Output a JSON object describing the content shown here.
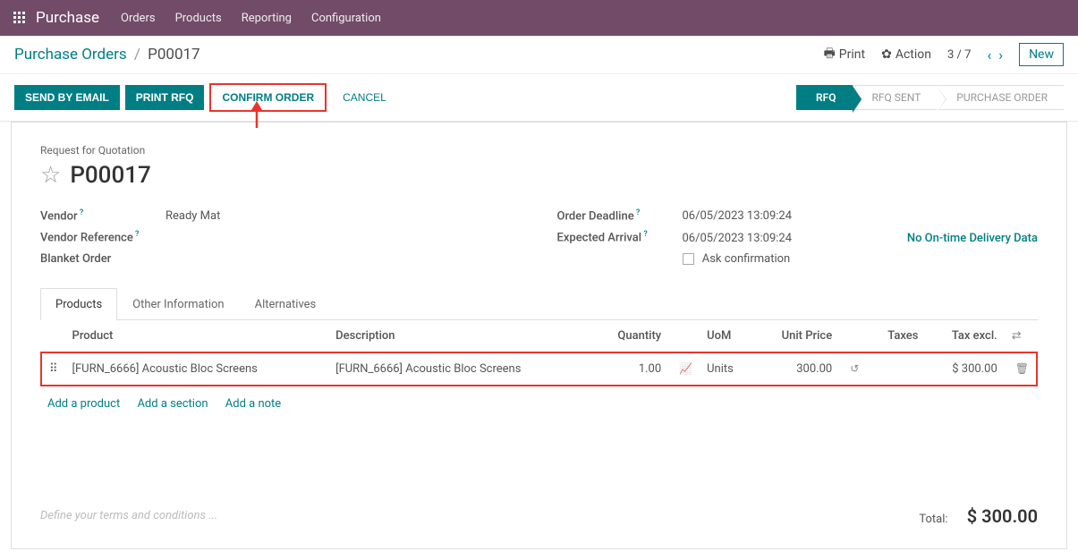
{
  "top": {
    "appname": "Purchase",
    "menu": [
      "Orders",
      "Products",
      "Reporting",
      "Configuration"
    ]
  },
  "breadcrumb": {
    "parent": "Purchase Orders",
    "current": "P00017"
  },
  "cp": {
    "print": "Print",
    "action": "Action",
    "pager": "3 / 7",
    "new": "New"
  },
  "actions": {
    "send": "SEND BY EMAIL",
    "printrfq": "PRINT RFQ",
    "confirm": "CONFIRM ORDER",
    "cancel": "CANCEL"
  },
  "status": {
    "s1": "RFQ",
    "s2": "RFQ SENT",
    "s3": "PURCHASE ORDER"
  },
  "header": {
    "subtitle": "Request for Quotation",
    "title": "P00017"
  },
  "fields": {
    "vendor_label": "Vendor",
    "vendor_value": "Ready Mat",
    "vendorref_label": "Vendor Reference",
    "blanket_label": "Blanket Order",
    "deadline_label": "Order Deadline",
    "deadline_value": "06/05/2023 13:09:24",
    "arrival_label": "Expected Arrival",
    "arrival_value": "06/05/2023 13:09:24",
    "askconfirm": "Ask confirmation",
    "delivery_link": "No On-time Delivery Data"
  },
  "tabs": {
    "t1": "Products",
    "t2": "Other Information",
    "t3": "Alternatives"
  },
  "cols": {
    "product": "Product",
    "description": "Description",
    "quantity": "Quantity",
    "uom": "UoM",
    "unitprice": "Unit Price",
    "taxes": "Taxes",
    "taxexcl": "Tax excl."
  },
  "line": {
    "product": "[FURN_6666] Acoustic Bloc Screens",
    "description": "[FURN_6666] Acoustic Bloc Screens",
    "qty": "1.00",
    "uom": "Units",
    "price": "300.00",
    "subtotal": "$ 300.00"
  },
  "addrow": {
    "product": "Add a product",
    "section": "Add a section",
    "note": "Add a note"
  },
  "footer": {
    "terms_placeholder": "Define your terms and conditions ...",
    "total_label": "Total:",
    "total_value": "$ 300.00"
  }
}
